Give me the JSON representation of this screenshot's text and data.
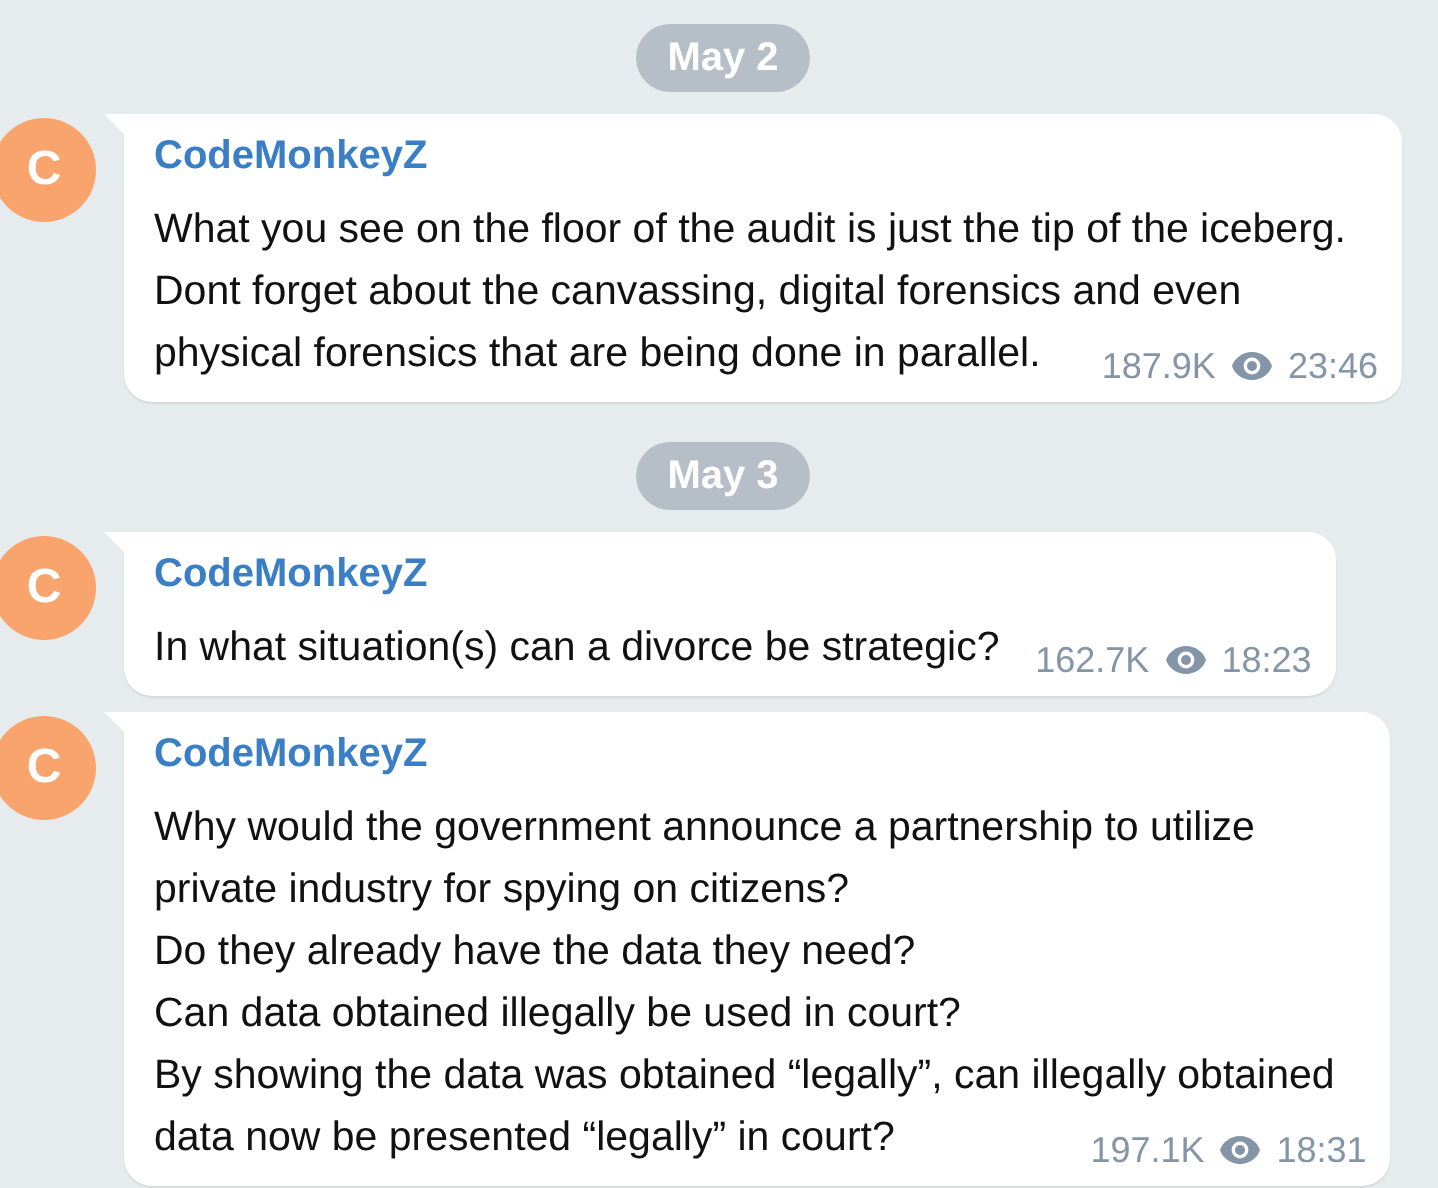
{
  "feed": [
    {
      "kind": "date",
      "label": "May 2"
    },
    {
      "kind": "message",
      "avatar": "C",
      "author": "CodeMonkeyZ",
      "lines": [
        "What you see on the floor of the audit is just the tip of the iceberg.",
        "Dont forget about the canvassing, digital forensics and even",
        "physical forensics that are being done in parallel."
      ],
      "views": "187.9K",
      "time": "23:46"
    },
    {
      "kind": "date",
      "label": "May 3"
    },
    {
      "kind": "message",
      "avatar": "C",
      "author": "CodeMonkeyZ",
      "lines": [
        "In what situation(s) can a divorce be strategic?"
      ],
      "views": "162.7K",
      "time": "18:23"
    },
    {
      "kind": "message",
      "avatar": "C",
      "author": "CodeMonkeyZ",
      "lines": [
        "Why would the government announce a partnership to utilize",
        "private industry for spying on citizens?",
        "Do they already have the data they need?",
        "Can data obtained illegally be used in court?",
        "By showing the data was obtained “legally”, can illegally obtained",
        "data now be presented “legally” in court?"
      ],
      "views": "197.1K",
      "time": "18:31"
    }
  ]
}
